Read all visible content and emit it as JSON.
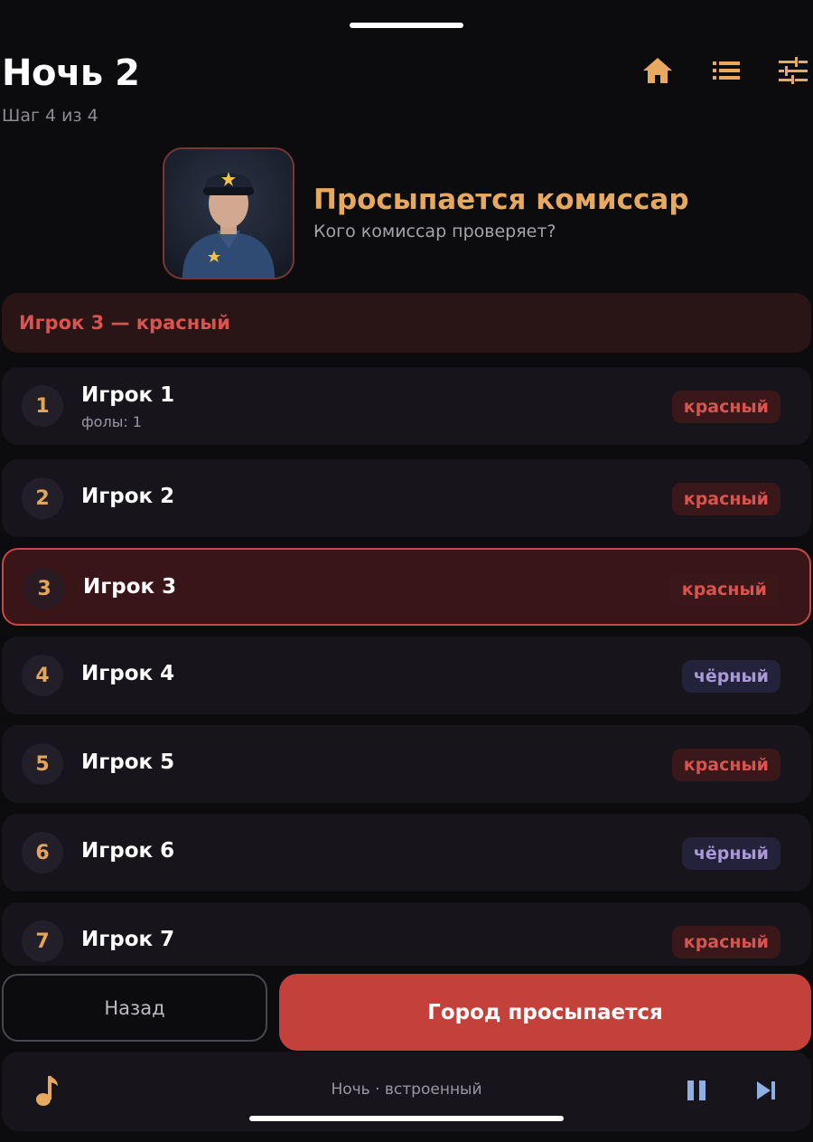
{
  "header": {
    "title": "Ночь 2",
    "step": "Шаг 4 из 4"
  },
  "icons": {
    "home": "home-icon",
    "list": "list-icon",
    "settings": "sliders-icon",
    "accent_color": "#e7a860"
  },
  "role": {
    "title": "Просыпается комиссар",
    "question": "Кого комиссар проверяет?"
  },
  "result": {
    "text": "Игрок 3 — красный"
  },
  "players": [
    {
      "number": "1",
      "name": "Игрок 1",
      "fouls": "фолы: 1",
      "team": "красный",
      "team_kind": "red",
      "selected": false
    },
    {
      "number": "2",
      "name": "Игрок 2",
      "fouls": "",
      "team": "красный",
      "team_kind": "red",
      "selected": false
    },
    {
      "number": "3",
      "name": "Игрок 3",
      "fouls": "",
      "team": "красный",
      "team_kind": "red",
      "selected": true
    },
    {
      "number": "4",
      "name": "Игрок 4",
      "fouls": "",
      "team": "чёрный",
      "team_kind": "black",
      "selected": false
    },
    {
      "number": "5",
      "name": "Игрок 5",
      "fouls": "",
      "team": "красный",
      "team_kind": "red",
      "selected": false
    },
    {
      "number": "6",
      "name": "Игрок 6",
      "fouls": "",
      "team": "чёрный",
      "team_kind": "black",
      "selected": false
    },
    {
      "number": "7",
      "name": "Игрок 7",
      "fouls": "",
      "team": "красный",
      "team_kind": "red",
      "selected": false
    }
  ],
  "actions": {
    "back": "Назад",
    "wake": "Город просыпается"
  },
  "music": {
    "track": "Ночь · встроенный"
  },
  "colors": {
    "red_team": "#d9534f",
    "black_team": "#a99ad6",
    "primary_button": "#c4403b"
  }
}
